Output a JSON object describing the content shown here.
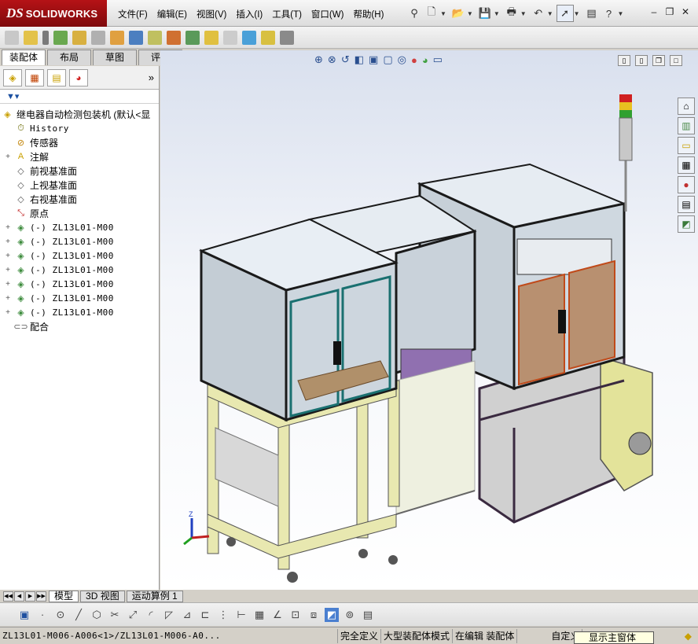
{
  "app": {
    "ds": "DS",
    "brand": "SOLIDWORKS"
  },
  "menu": [
    "文件(F)",
    "编辑(E)",
    "视图(V)",
    "插入(I)",
    "工具(T)",
    "窗口(W)",
    "帮助(H)"
  ],
  "cm_tabs": [
    "装配体",
    "布局",
    "草图",
    "评估"
  ],
  "tree": {
    "root": "继电器自动检测包装机  (默认<显",
    "items": [
      {
        "label": "History",
        "icon": "history-icon",
        "expand": ""
      },
      {
        "label": "传感器",
        "icon": "sensor-icon",
        "expand": ""
      },
      {
        "label": "注解",
        "icon": "annotation-icon",
        "expand": "+"
      },
      {
        "label": "前视基准面",
        "icon": "plane-icon",
        "expand": ""
      },
      {
        "label": "上视基准面",
        "icon": "plane-icon",
        "expand": ""
      },
      {
        "label": "右视基准面",
        "icon": "plane-icon",
        "expand": ""
      },
      {
        "label": "原点",
        "icon": "origin-icon",
        "expand": ""
      },
      {
        "label": "(-) ZL13L01-M00",
        "icon": "subassembly-icon",
        "expand": "+"
      },
      {
        "label": "(-) ZL13L01-M00",
        "icon": "subassembly-icon",
        "expand": "+"
      },
      {
        "label": "(-) ZL13L01-M00",
        "icon": "subassembly-icon",
        "expand": "+"
      },
      {
        "label": "(-) ZL13L01-M00",
        "icon": "subassembly-icon",
        "expand": "+"
      },
      {
        "label": "(-) ZL13L01-M00",
        "icon": "subassembly-icon",
        "expand": "+"
      },
      {
        "label": "(-) ZL13L01-M00",
        "icon": "subassembly-icon",
        "expand": "+"
      },
      {
        "label": "(-) ZL13L01-M00",
        "icon": "subassembly-icon",
        "expand": "+"
      },
      {
        "label": "配合",
        "icon": "mates-icon",
        "expand": ""
      }
    ]
  },
  "bottom_tabs": [
    "模型",
    "3D 视图",
    "运动算例 1"
  ],
  "status": {
    "path": "ZL13L01-M006-A006<1>/ZL13L01-M006-A0...",
    "defined": "完全定义",
    "mode": "大型装配体模式",
    "editing": "在编辑 装配体",
    "custom": "自定义",
    "tooltip": "显示主窗体"
  },
  "colors": {
    "logo_red": "#a4121a",
    "frame_yellow": "#e8e8b0",
    "frame_dark": "#3a3a3a",
    "glass": "#cfd8e0"
  }
}
